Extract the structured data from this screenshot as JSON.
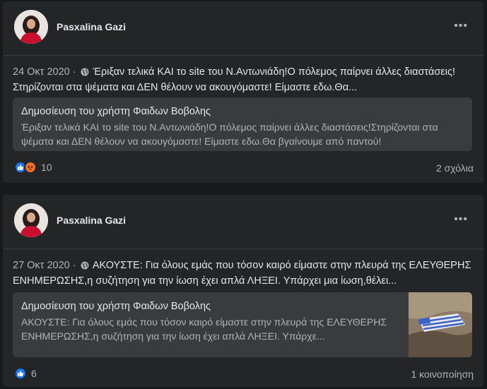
{
  "posts": [
    {
      "author": "Pasxalina Gazi",
      "date": "24 Οκτ 2020",
      "separator": "·",
      "text": "Έριξαν τελικά ΚΑΙ το site του Ν.Αντωνιάδη!Ο πόλεμος παίρνει άλλες διαστάσεις!Στηρίζονται στα ψέματα και ΔΕΝ θέλουν να ακουγόμαστε! Είμαστε εδω.Θα...",
      "shared_title": "Δημοσίευση του χρήστη Φαιδων Βοβολης",
      "shared_text": "Έριξαν τελικά ΚΑΙ το site του Ν.Αντωνιάδη!Ο πόλεμος παίρνει άλλες διαστάσεις!Στηρίζονται στα ψέματα και ΔΕΝ θέλουν να ακουγόμαστε! Είμαστε εδω.Θα βγαίνουμε από παντού!",
      "reaction_count": "10",
      "footer_right": "2 σχόλια"
    },
    {
      "author": "Pasxalina Gazi",
      "date": "27 Οκτ 2020",
      "separator": "·",
      "text": "ΑΚΟΥΣΤΕ: Για όλους εμάς που τόσον καιρό είμαστε στην πλευρά της ΕΛΕΥΘΕΡΗΣ ΕΝΗΜΕΡΩΣΗΣ,η συζήτηση για την ίωση έχει απλά ΛΗΞΕΙ. Υπάρχει μια ίωση,θέλει...",
      "shared_title": "Δημοσίευση του χρήστη Φαιδων Βοβολης",
      "shared_text": "ΑΚΟΥΣΤΕ: Για όλους εμάς που τόσον καιρό είμαστε στην πλευρά της ΕΛΕΥΘΕΡΗΣ ΕΝΗΜΕΡΩΣΗΣ,η συζήτηση για την ίωση έχει απλά ΛΗΞΕΙ. Υπάρχε...",
      "reaction_count": "6",
      "footer_right": "1 κοινοποίηση"
    }
  ],
  "icons": {
    "more": "more-options-icon",
    "globe": "globe-icon",
    "like": "like-reaction-icon",
    "angry": "angry-reaction-icon"
  },
  "colors": {
    "background": "#18191a",
    "card": "#242526",
    "quote": "#3a3b3c",
    "like_blue": "#1877f2",
    "angry_orange": "#f0702a"
  }
}
